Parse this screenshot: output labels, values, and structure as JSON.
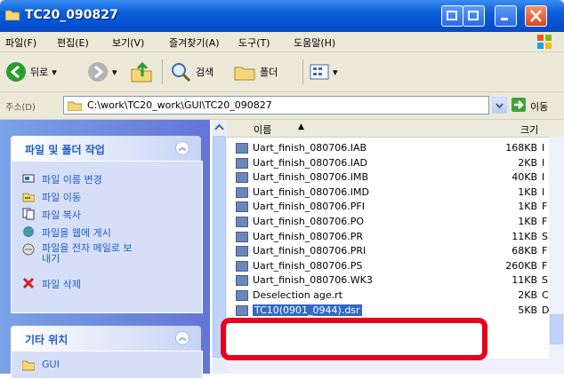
{
  "window": {
    "title": "TC20_090827"
  },
  "menu": [
    "파일(F)",
    "편집(E)",
    "보기(V)",
    "즐겨찾기(A)",
    "도구(T)",
    "도움말(H)"
  ],
  "toolbar": {
    "back": "뒤로",
    "search": "검색",
    "folders": "폴더"
  },
  "address": {
    "label": "주소(D)",
    "path": "C:\\work\\TC20_work\\GUI\\TC20_090827",
    "go": "이동"
  },
  "file_tasks": {
    "title": "파일 및 폴더 작업",
    "items": [
      {
        "label": "파일 이름 변경",
        "icon": "rename-icon"
      },
      {
        "label": "파일 이동",
        "icon": "move-icon"
      },
      {
        "label": "파일 복사",
        "icon": "copy-icon"
      },
      {
        "label": "파일을 웹에 게시",
        "icon": "web-publish-icon"
      },
      {
        "label": "파일을 전자 메일로 보내기",
        "icon": "email-icon"
      },
      {
        "label": "파일 삭제",
        "icon": "delete-icon"
      }
    ]
  },
  "other_places": {
    "title": "기타 위치",
    "first_item": "GUI"
  },
  "columns": {
    "name": "이름",
    "size": "크기"
  },
  "files": [
    {
      "name": "Uart_finish_080706.IAB",
      "size": "168KB",
      "type": "I"
    },
    {
      "name": "Uart_finish_080706.IAD",
      "size": "2KB",
      "type": "I"
    },
    {
      "name": "Uart_finish_080706.IMB",
      "size": "40KB",
      "type": "I"
    },
    {
      "name": "Uart_finish_080706.IMD",
      "size": "1KB",
      "type": "I"
    },
    {
      "name": "Uart_finish_080706.PFI",
      "size": "1KB",
      "type": "F"
    },
    {
      "name": "Uart_finish_080706.PO",
      "size": "1KB",
      "type": "F"
    },
    {
      "name": "Uart_finish_080706.PR",
      "size": "11KB",
      "type": "S"
    },
    {
      "name": "Uart_finish_080706.PRI",
      "size": "68KB",
      "type": "F"
    },
    {
      "name": "Uart_finish_080706.PS",
      "size": "260KB",
      "type": "F"
    },
    {
      "name": "Uart_finish_080706.WK3",
      "size": "11KB",
      "type": "S"
    },
    {
      "name": "Deselection age.rt",
      "size": "2KB",
      "type": "C"
    },
    {
      "name": "TC10(0901_0944).dsr",
      "size": "5KB",
      "type": "D"
    }
  ],
  "colors": {
    "selection": "#316ac5",
    "highlight_box": "#e8001c",
    "titlebar": "#0a5fd8",
    "taskpane": "#7ba2e7"
  }
}
